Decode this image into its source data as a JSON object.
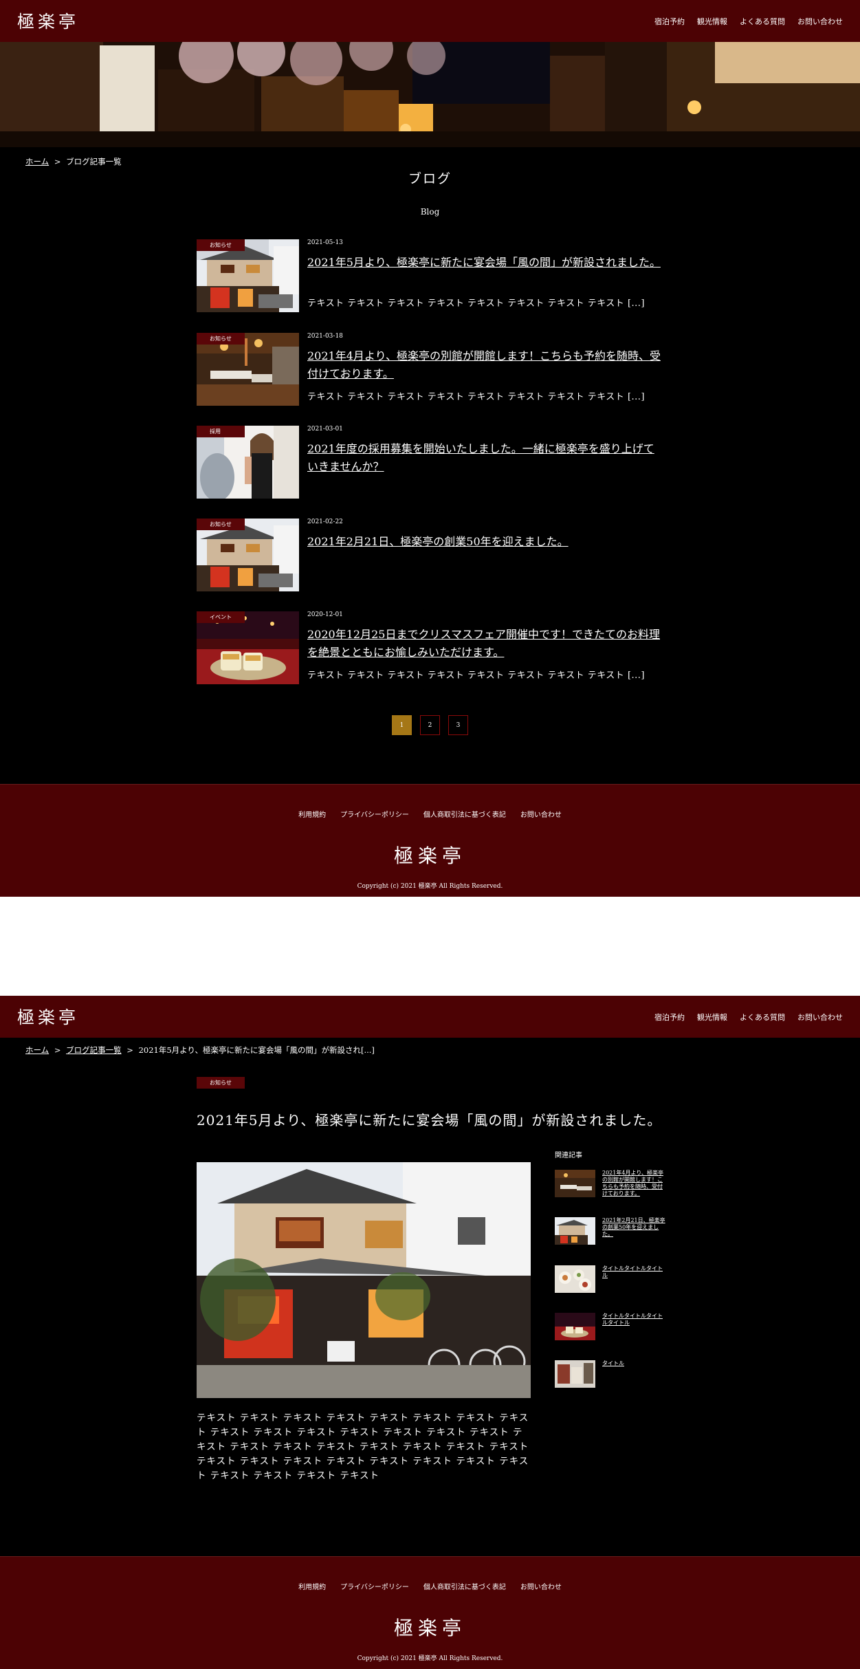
{
  "site": {
    "logo": "極楽亭",
    "nav": [
      "宿泊予約",
      "観光情報",
      "よくある質問",
      "お問い合わせ"
    ]
  },
  "list_page": {
    "breadcrumb": {
      "home": "ホーム",
      "separator": ">",
      "current": "ブログ記事一覧"
    },
    "title": "ブログ",
    "subtitle": "Blog",
    "posts": [
      {
        "category": "お知らせ",
        "date": "2021-05-13",
        "title": "2021年5月より、極楽亭に新たに宴会場「風の間」が新設されました。",
        "excerpt": "テキスト テキスト テキスト テキスト テキスト テキスト テキスト テキスト [...]"
      },
      {
        "category": "お知らせ",
        "date": "2021-03-18",
        "title": "2021年4月より、極楽亭の別館が開館します！こちらも予約を随時、受付けております。",
        "excerpt": "テキスト テキスト テキスト テキスト テキスト テキスト テキスト テキスト [...]"
      },
      {
        "category": "採用",
        "date": "2021-03-01",
        "title": "2021年度の採用募集を開始いたしました。一緒に極楽亭を盛り上げていきませんか？",
        "excerpt": ""
      },
      {
        "category": "お知らせ",
        "date": "2021-02-22",
        "title": "2021年2月21日、極楽亭の創業50年を迎えました。",
        "excerpt": ""
      },
      {
        "category": "イベント",
        "date": "2020-12-01",
        "title": "2020年12月25日までクリスマスフェア開催中です！できたてのお料理を絶景とともにお愉しみいただけます。",
        "excerpt": "テキスト テキスト テキスト テキスト テキスト テキスト テキスト テキスト [...]"
      }
    ],
    "pagination": {
      "pages": [
        "1",
        "2",
        "3"
      ],
      "current": "1"
    }
  },
  "detail_page": {
    "breadcrumb": {
      "home": "ホーム",
      "list": "ブログ記事一覧",
      "separator": ">",
      "current": "2021年5月より、極楽亭に新たに宴会場「風の間」が新設され[...]"
    },
    "category": "お知らせ",
    "title": "2021年5月より、極楽亭に新たに宴会場「風の間」が新設されました。",
    "body": "テキスト テキスト テキスト テキスト テキスト テキスト テキスト テキスト テキスト テキスト テキスト テキスト テキスト テキスト テキスト テキスト テキスト テキスト テキスト テキスト テキスト テキスト テキスト テキスト テキスト テキスト テキスト テキスト テキスト テキスト テキスト テキスト テキスト テキスト テキスト",
    "related_heading": "関連記事",
    "related": [
      {
        "title": "2021年4月より、極楽亭の別館が開館します！こちらも予約を随時、受付けております。"
      },
      {
        "title": "2021年2月21日、極楽亭の創業50年を迎えました。"
      },
      {
        "title": "タイトルタイトルタイトル"
      },
      {
        "title": "タイトルタイトルタイトルタイトル"
      },
      {
        "title": "タイトル"
      }
    ]
  },
  "footer": {
    "links": [
      "利用規約",
      "プライバシーポリシー",
      "個人商取引法に基づく表記",
      "お問い合わせ"
    ],
    "logo": "極楽亭",
    "copyright": "Copyright (c) 2021 極楽亭 All Rights Reserved."
  },
  "colors": {
    "header_bg": "#4c0204",
    "badge_bg": "#5a0608",
    "pager_active": "#a57716",
    "page_bg": "#000000"
  }
}
